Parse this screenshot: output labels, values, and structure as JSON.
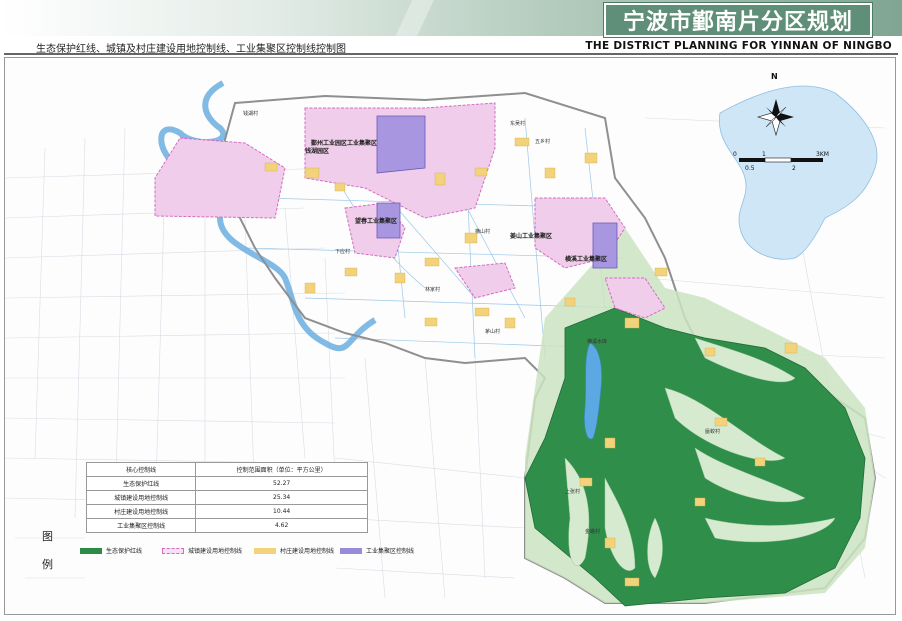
{
  "header": {
    "title": "宁波市鄞南片分区规划",
    "subtitle_cn": "生态保护红线、城镇及村庄建设用地控制线、工业集聚区控制线控制图",
    "subtitle_en": "THE DISTRICT PLANNING FOR YINNAN OF NINGBO"
  },
  "map": {
    "zone_labels": [
      "鄞州工业园区工业集聚区",
      "望春工业集聚区",
      "姜山工业集聚区",
      "横溪工业集聚区",
      "钱湖园区"
    ],
    "village_labels": [
      "钱湖村",
      "东吴村",
      "横山村",
      "林家村",
      "金峨村",
      "上张村",
      "下应村",
      "五乡村",
      "茅山村",
      "蜃蛟村"
    ],
    "reservoir_label": "横溪水库"
  },
  "compass": {
    "north": "N"
  },
  "scale": {
    "ticks": [
      "0",
      "1",
      "3KM"
    ],
    "sub_ticks": [
      "0.5",
      "2"
    ]
  },
  "table": {
    "headers": [
      "核心控制线",
      "控制范围面积（单位：平方公里）"
    ],
    "rows": [
      {
        "name": "生态保护红线",
        "value": "52.27"
      },
      {
        "name": "城镇建设用地控制线",
        "value": "25.34"
      },
      {
        "name": "村庄建设用地控制线",
        "value": "10.44"
      },
      {
        "name": "工业集聚区控制线",
        "value": "4.62"
      }
    ]
  },
  "legend": {
    "title_line1": "图",
    "title_line2": "例",
    "items": [
      {
        "label": "生态保护红线",
        "color": "#2e8b46"
      },
      {
        "label": "城镇建设用地控制线",
        "color": "#e58fd4"
      },
      {
        "label": "村庄建设用地控制线",
        "color": "#f2d27a"
      },
      {
        "label": "工业集聚区控制线",
        "color": "#9a8bd8"
      }
    ]
  }
}
